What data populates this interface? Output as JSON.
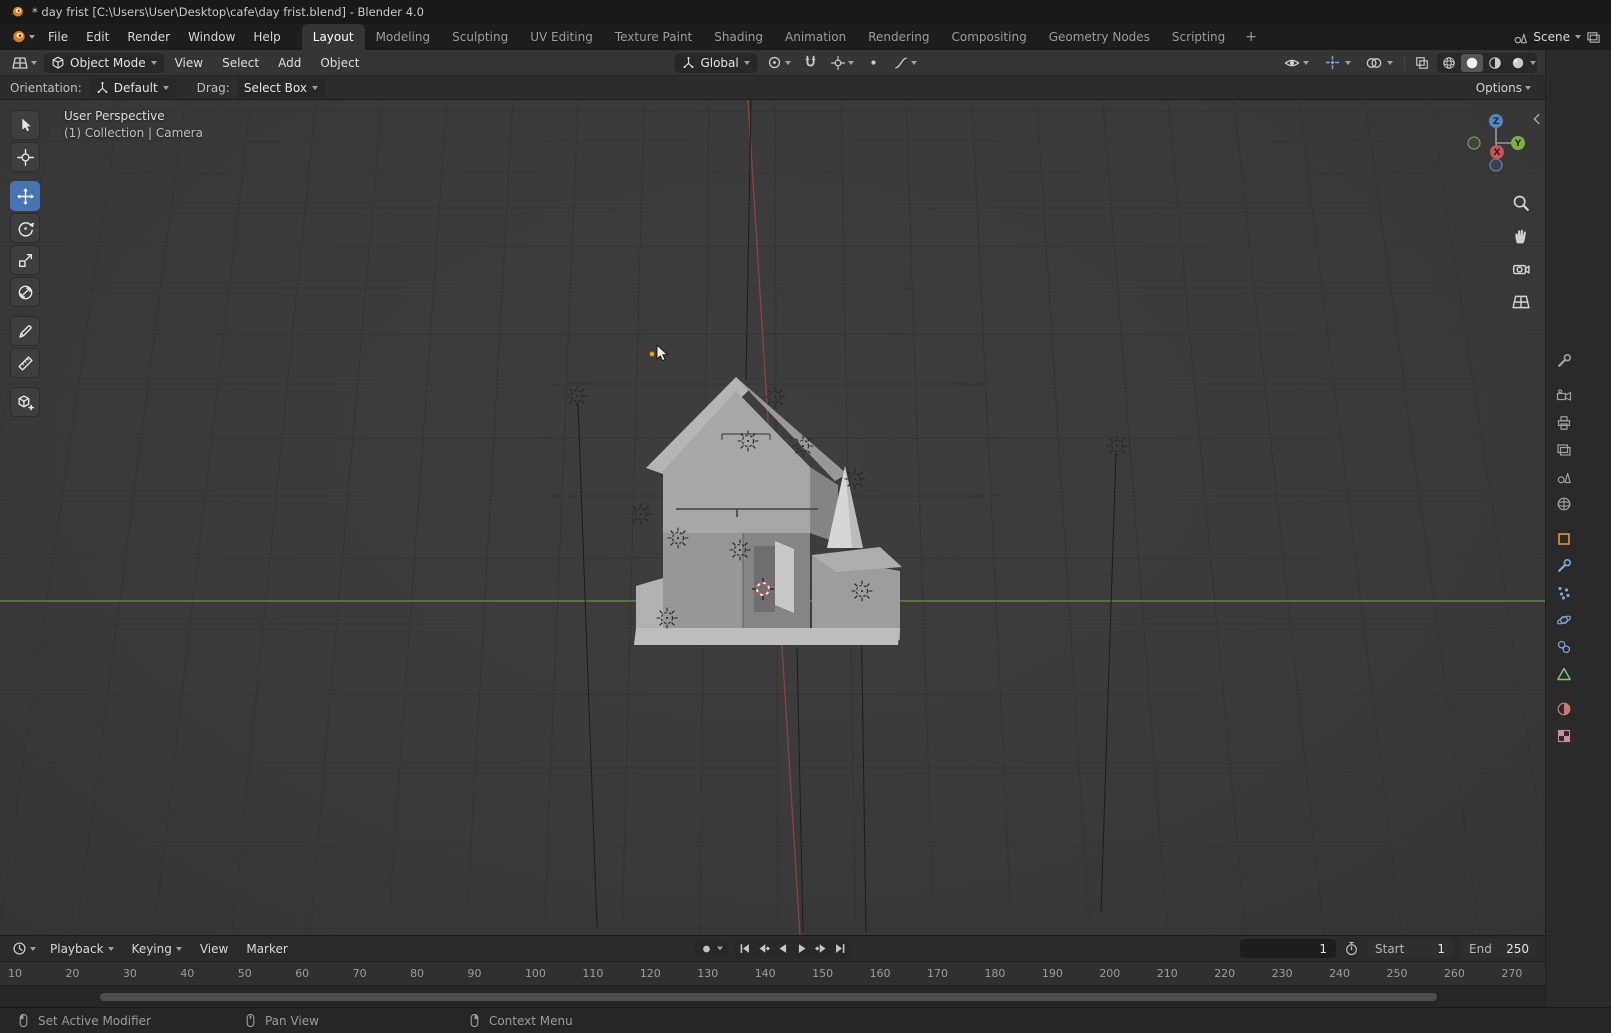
{
  "titlebar": {
    "title": "* day frist [C:\\Users\\User\\Desktop\\cafe\\day frist.blend] - Blender 4.0"
  },
  "topbar": {
    "menus": [
      "File",
      "Edit",
      "Render",
      "Window",
      "Help"
    ],
    "workspaces": [
      "Layout",
      "Modeling",
      "Sculpting",
      "UV Editing",
      "Texture Paint",
      "Shading",
      "Animation",
      "Rendering",
      "Compositing",
      "Geometry Nodes",
      "Scripting"
    ],
    "active_workspace": "Layout",
    "add_workspace_label": "+",
    "scene_name": "Scene"
  },
  "viewport_header": {
    "mode": "Object Mode",
    "menus": [
      "View",
      "Select",
      "Add",
      "Object"
    ],
    "orientation": "Global"
  },
  "tool_settings": {
    "orientation_label": "Orientation:",
    "orientation_value": "Default",
    "drag_label": "Drag:",
    "drag_value": "Select Box",
    "options_label": "Options"
  },
  "viewport": {
    "view_label": "User Perspective",
    "context_label": "(1) Collection | Camera",
    "gizmo": {
      "x": "X",
      "y": "Y",
      "z": "Z"
    },
    "left_toolbar_tools": [
      "select-box",
      "cursor",
      "move",
      "rotate",
      "scale",
      "transform",
      "annotate",
      "measure",
      "add-cube"
    ],
    "active_tool": "move"
  },
  "properties_tabs": [
    "tool",
    "render",
    "output",
    "view-layer",
    "scene",
    "world",
    "object",
    "modifiers",
    "particles",
    "physics",
    "constraints",
    "object-data",
    "material",
    "texture"
  ],
  "timeline": {
    "menus": [
      "Playback",
      "Keying",
      "View",
      "Marker"
    ],
    "current_frame": "1",
    "start_label": "Start",
    "start_value": "1",
    "end_label": "End",
    "end_value": "250",
    "ticks": [
      "10",
      "20",
      "30",
      "40",
      "50",
      "60",
      "70",
      "80",
      "90",
      "100",
      "110",
      "120",
      "130",
      "140",
      "150",
      "160",
      "170",
      "180",
      "190",
      "200",
      "210",
      "220",
      "230",
      "240",
      "250",
      "260",
      "270"
    ]
  },
  "statusbar": {
    "items": [
      {
        "button": "left-mouse",
        "label": "Set Active Modifier"
      },
      {
        "button": "middle-mouse",
        "label": "Pan View"
      },
      {
        "button": "right-mouse",
        "label": "Context Menu"
      }
    ]
  },
  "colors": {
    "accent": "#4772b3",
    "axis_x": "#8f4044",
    "axis_y": "#6a8f45",
    "selected_object": "#ef9f3e"
  }
}
